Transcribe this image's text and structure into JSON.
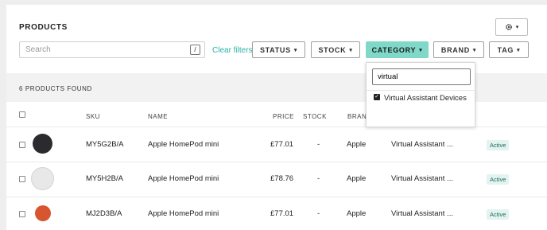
{
  "header": {
    "title": "PRODUCTS",
    "settings_caret": "▾"
  },
  "search": {
    "placeholder": "Search",
    "shortcut": "/"
  },
  "clear_filters": "Clear filters",
  "filters": [
    {
      "label": "STATUS",
      "active": false
    },
    {
      "label": "STOCK",
      "active": false
    },
    {
      "label": "CATEGORY",
      "active": true
    },
    {
      "label": "BRAND",
      "active": false
    },
    {
      "label": "TAG",
      "active": false
    }
  ],
  "caret": "▾",
  "results": {
    "count_text": "6 PRODUCTS FOUND"
  },
  "columns": {
    "sku": "SKU",
    "name": "NAME",
    "price": "PRICE",
    "stock": "STOCK",
    "brand": "BRAND"
  },
  "rows": [
    {
      "sku": "MY5G2B/A",
      "name": "Apple HomePod mini",
      "price": "£77.01",
      "stock": "-",
      "brand": "Apple",
      "category": "Virtual Assistant ...",
      "status": "Active",
      "thumb_color": "#2b2b2d"
    },
    {
      "sku": "MY5H2B/A",
      "name": "Apple HomePod mini",
      "price": "£78.76",
      "stock": "-",
      "brand": "Apple",
      "category": "Virtual Assistant ...",
      "status": "Active",
      "thumb_color": "#e8e8e8"
    },
    {
      "sku": "MJ2D3B/A",
      "name": "Apple HomePod mini",
      "price": "£77.01",
      "stock": "-",
      "brand": "Apple",
      "category": "Virtual Assistant ...",
      "status": "Active",
      "thumb_color": "#d8562f"
    }
  ],
  "category_dropdown": {
    "search_value": "virtual",
    "options": [
      {
        "label": "Virtual Assistant Devices",
        "checked": true
      }
    ]
  },
  "colors": {
    "accent": "#7fd8c8",
    "link": "#2bb3a3"
  }
}
